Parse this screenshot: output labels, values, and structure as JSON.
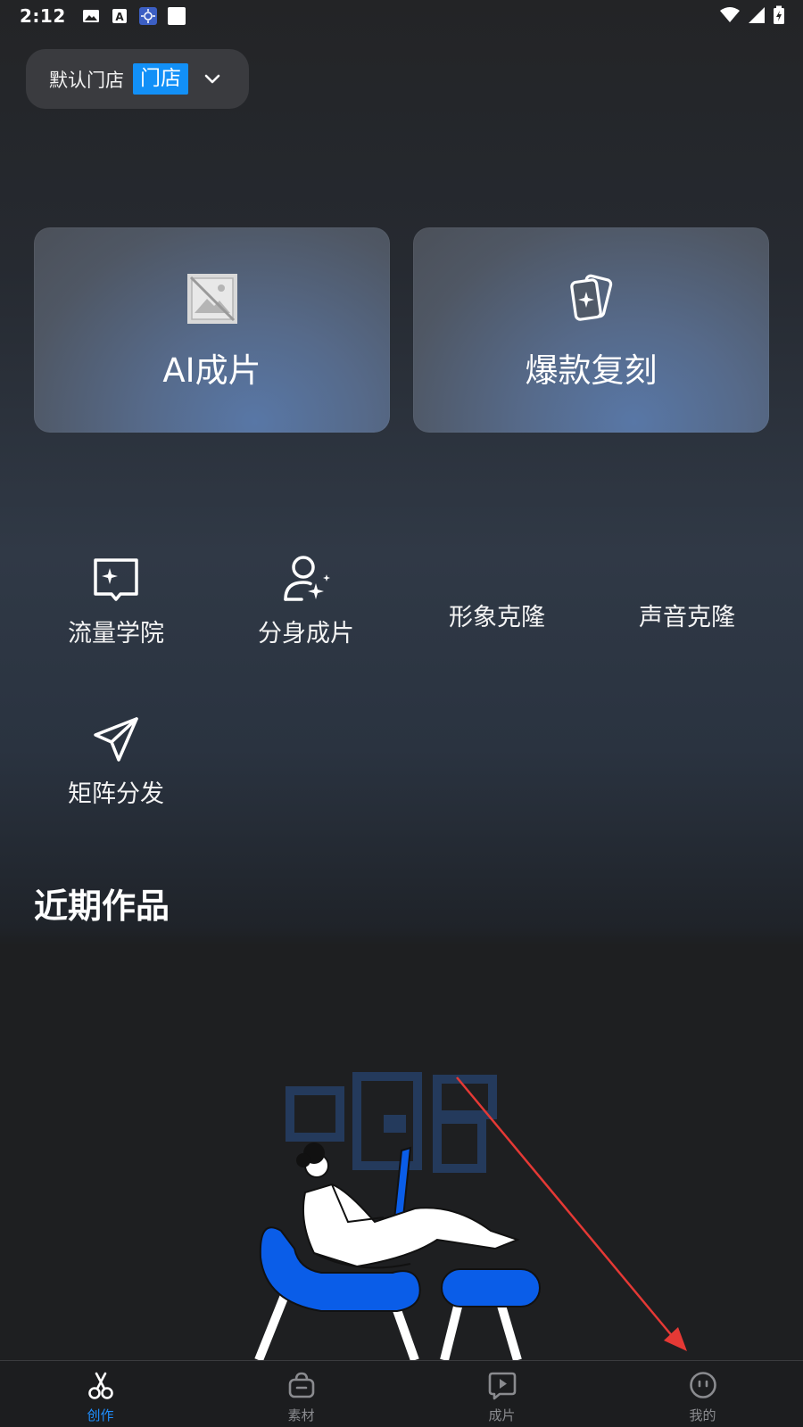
{
  "status_bar": {
    "time": "2:12",
    "icons": [
      "image-icon",
      "font-icon",
      "app-icon",
      "blank-icon"
    ],
    "right_icons": [
      "wifi-icon",
      "signal-icon",
      "battery-charging-icon"
    ]
  },
  "store_selector": {
    "name": "默认门店",
    "tag": "门店",
    "icon": "chevron-down-icon"
  },
  "feature_cards": [
    {
      "label": "AI成片",
      "icon": "broken-image-icon"
    },
    {
      "label": "爆款复刻",
      "icon": "sparkle-cards-icon"
    }
  ],
  "tools": [
    {
      "label": "流量学院",
      "icon": "book-sparkle-icon"
    },
    {
      "label": "分身成片",
      "icon": "person-sparkle-icon"
    },
    {
      "label": "形象克隆",
      "icon": ""
    },
    {
      "label": "声音克隆",
      "icon": ""
    },
    {
      "label": "矩阵分发",
      "icon": "send-icon"
    }
  ],
  "recent_section": {
    "title": "近期作品"
  },
  "bottom_nav": [
    {
      "label": "创作",
      "icon": "scissors-icon",
      "active": true
    },
    {
      "label": "素材",
      "icon": "bag-icon",
      "active": false
    },
    {
      "label": "成片",
      "icon": "play-bubble-icon",
      "active": false
    },
    {
      "label": "我的",
      "icon": "face-icon",
      "active": false
    }
  ],
  "colors": {
    "accent": "#1f8fff",
    "tag_blue": "#1290f7",
    "annotation_red": "#e53935"
  }
}
